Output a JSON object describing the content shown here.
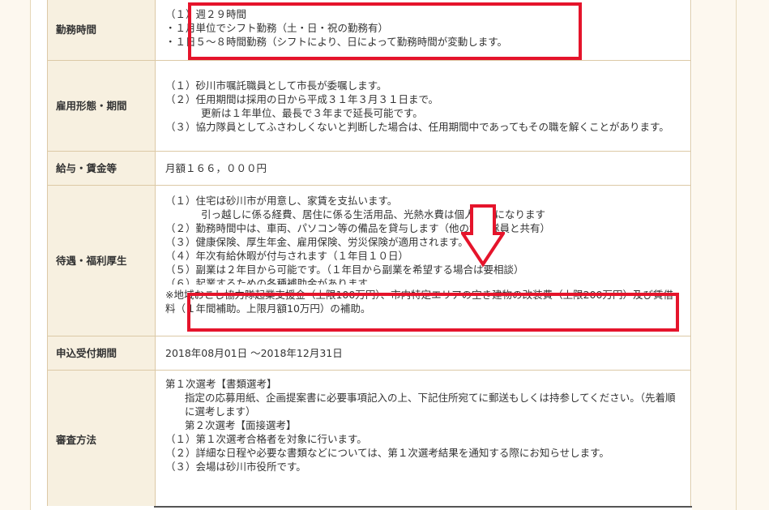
{
  "rows": [
    {
      "header": "勤務時間",
      "lines": [
        "（１）週２９時間",
        "・１月単位でシフト勤務（土・日・祝の勤務有）",
        "・１日５～８時間勤務（シフトにより、日によって勤務時間が変動します。"
      ]
    },
    {
      "header": "雇用形態・期間",
      "lines": [
        "（１）砂川市嘱託職員として市長が委嘱します。",
        "（２）任用期間は採用の日から平成３１年３月３１日まで。",
        "更新は１年単位、最長で３年まで延長可能です。",
        "（３）協力隊員としてふさわしくないと判断した場合は、任用期間中であってもその職を解くことがあります。"
      ]
    },
    {
      "header": "給与・賃金等",
      "lines": [
        "月額１６６，０００円"
      ]
    },
    {
      "header": "待遇・福利厚生",
      "lines": [
        "（１）住宅は砂川市が用意し、家賃を支払います。",
        "引っ越しに係る経費、居住に係る生活用品、光熱水費は個人負担になります",
        "（２）勤務時間中は、車両、パソコン等の備品を貸与します（他の協力隊員と共有）",
        "（３）健康保険、厚生年金、雇用保険、労災保険が適用されます。",
        "（４）年次有給休暇が付与されます（１年目１０日）",
        "（５）副業は２年目から可能です。（１年目から副業を希望する場合は要相談）",
        "（６）起業するための各種補助金があります。",
        "※地域おこし協力隊起業支援金（上限100万円）、市内特定エリアの空き建物の改装費（上限200万円）及び賃借料（１年間補助。上限月額10万円）の補助。"
      ]
    },
    {
      "header": "申込受付期間",
      "lines": [
        "2018年08月01日 ～2018年12月31日"
      ]
    },
    {
      "header": "審査方法",
      "lines": [
        "第１次選考【書類選考】",
        "指定の応募用紙、企画提案書に必要事項記入の上、下記住所宛てに郵送もしくは持参してください。（先着順に選考します）",
        "第２次選考【面接選考】",
        "（１）第１次選考合格者を対象に行います。",
        "（２）詳細な日程や必要な書類などについては、第１次選考結果を通知する際にお知らせします。",
        "（３）会場は砂川市役所です。"
      ]
    }
  ],
  "colors": {
    "highlight": "#e5142b",
    "header_bg": "#f7f0e0",
    "border": "#dcc9a6"
  }
}
